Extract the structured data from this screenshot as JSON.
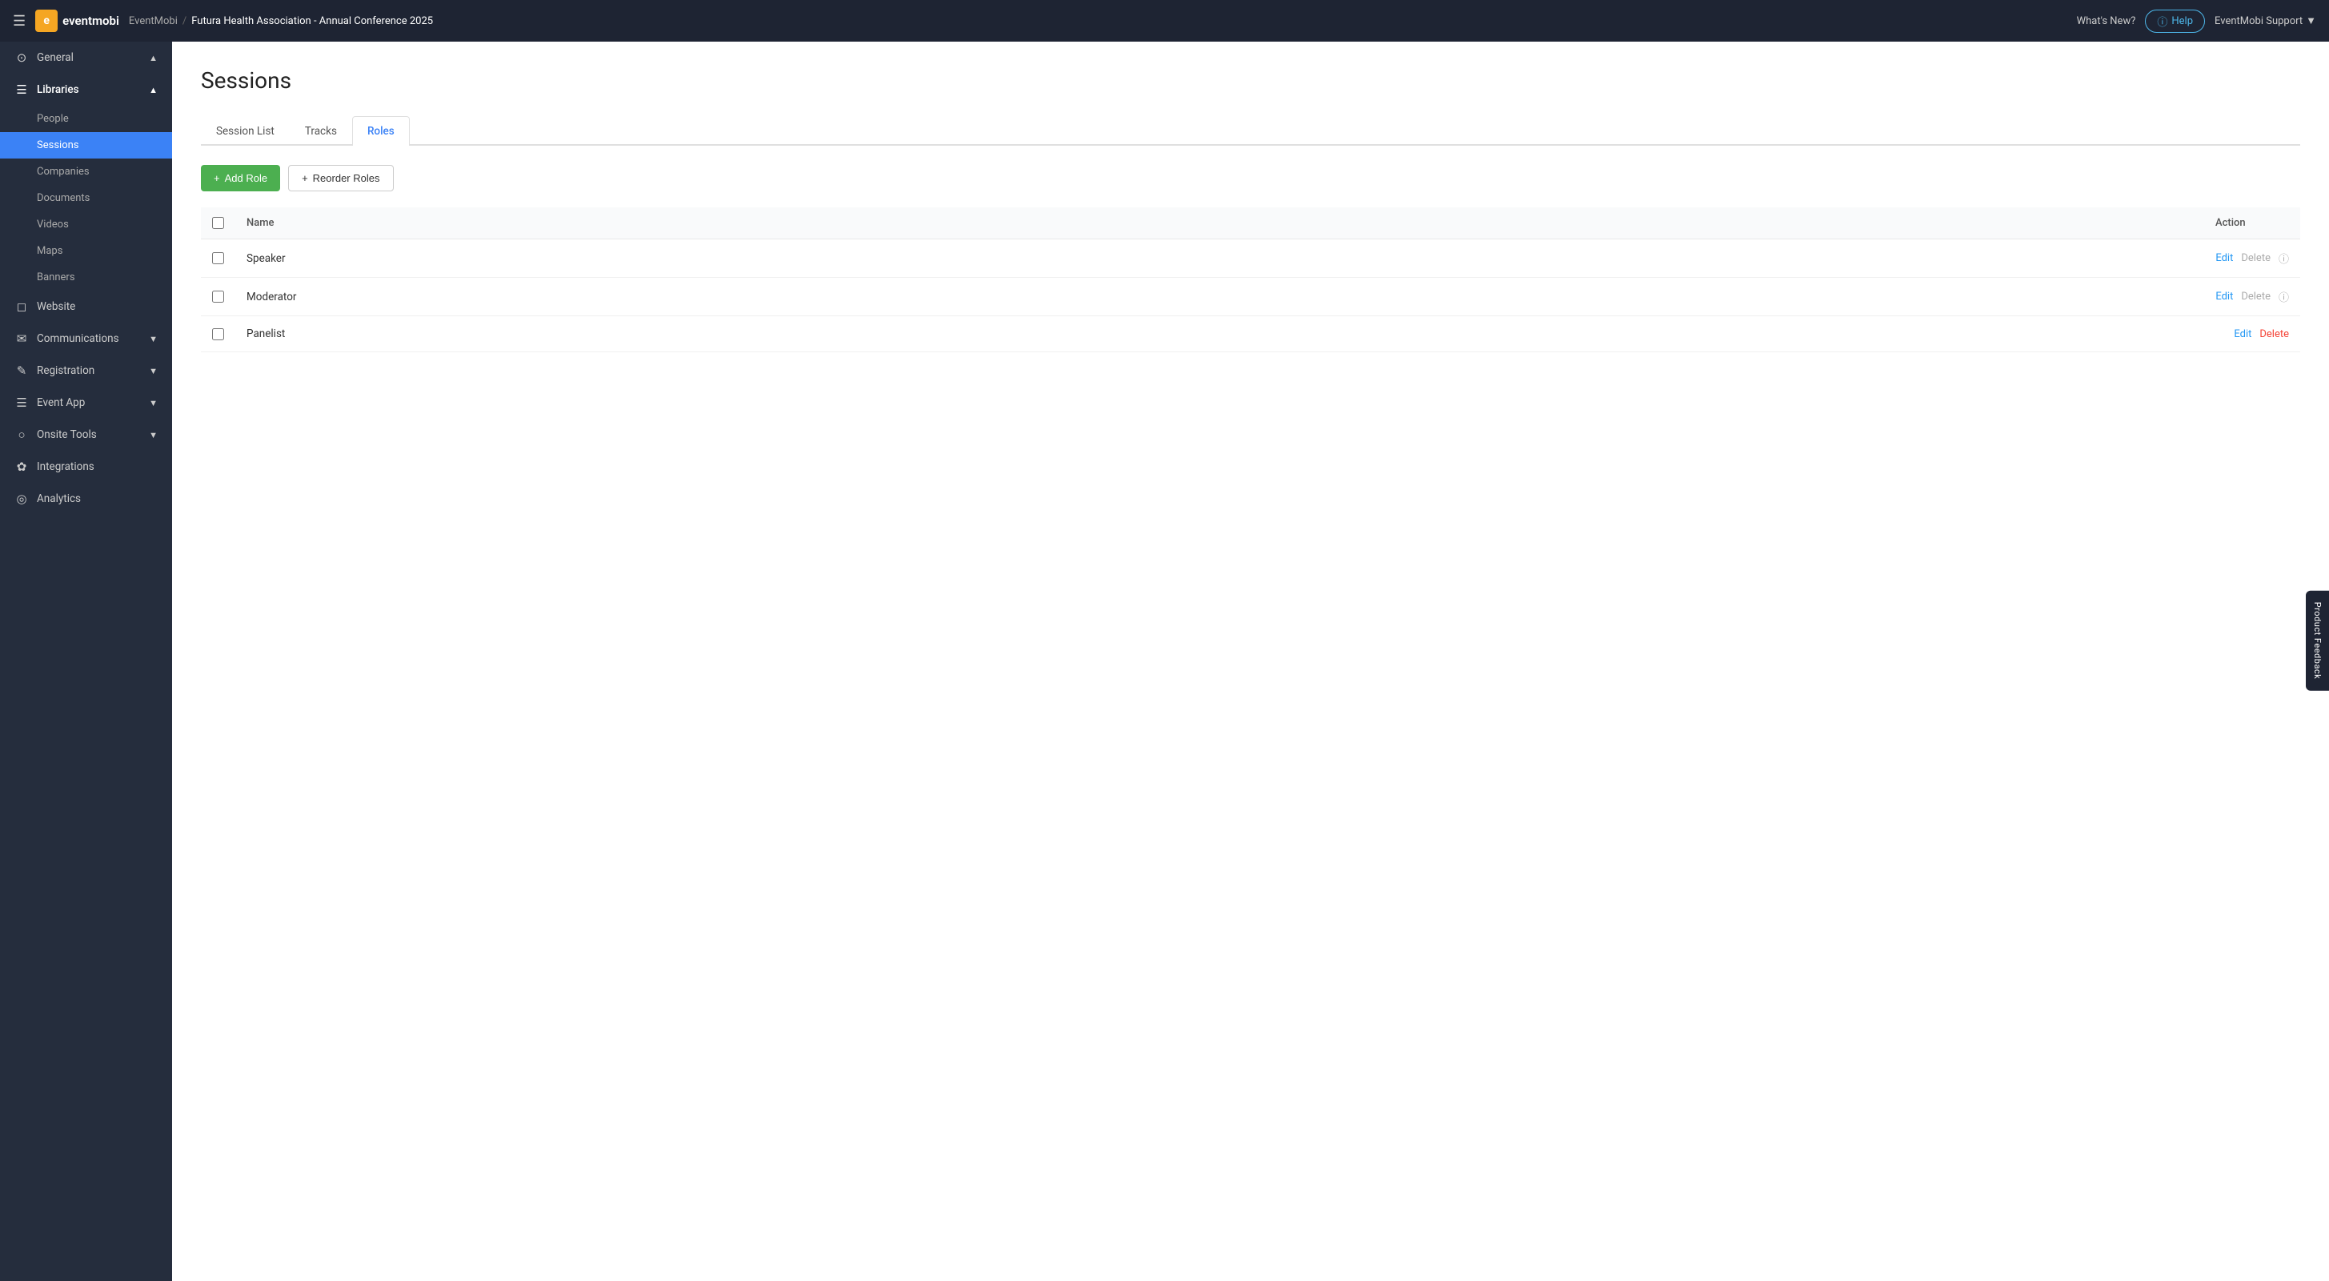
{
  "navbar": {
    "hamburger": "☰",
    "logo_icon": "e",
    "logo_text": "eventmobi",
    "breadcrumb_org": "EventMobi",
    "breadcrumb_sep": "/",
    "event_name": "Futura Health Association - Annual Conference 2025",
    "whats_new": "What's New?",
    "help_label": "Help",
    "support_label": "EventMobi Support"
  },
  "sidebar": {
    "items": [
      {
        "id": "general",
        "icon": "⊙",
        "label": "General",
        "has_chevron": true,
        "chevron": "▲"
      },
      {
        "id": "libraries",
        "icon": "☰",
        "label": "Libraries",
        "has_chevron": true,
        "chevron": "▲",
        "active": false,
        "section": true
      },
      {
        "id": "people",
        "icon": "",
        "label": "People",
        "sub": true
      },
      {
        "id": "sessions",
        "icon": "",
        "label": "Sessions",
        "sub": true,
        "active": true
      },
      {
        "id": "companies",
        "icon": "",
        "label": "Companies",
        "sub": true
      },
      {
        "id": "documents",
        "icon": "",
        "label": "Documents",
        "sub": true
      },
      {
        "id": "videos",
        "icon": "",
        "label": "Videos",
        "sub": true
      },
      {
        "id": "maps",
        "icon": "",
        "label": "Maps",
        "sub": true
      },
      {
        "id": "banners",
        "icon": "",
        "label": "Banners",
        "sub": true
      },
      {
        "id": "website",
        "icon": "⬡",
        "label": "Website",
        "has_chevron": false
      },
      {
        "id": "communications",
        "icon": "✉",
        "label": "Communications",
        "has_chevron": true,
        "chevron": "▼"
      },
      {
        "id": "registration",
        "icon": "✏",
        "label": "Registration",
        "has_chevron": true,
        "chevron": "▼"
      },
      {
        "id": "event-app",
        "icon": "☰",
        "label": "Event App",
        "has_chevron": true,
        "chevron": "▼"
      },
      {
        "id": "onsite-tools",
        "icon": "○",
        "label": "Onsite Tools",
        "has_chevron": true,
        "chevron": "▼"
      },
      {
        "id": "integrations",
        "icon": "✿",
        "label": "Integrations",
        "has_chevron": false
      },
      {
        "id": "analytics",
        "icon": "◎",
        "label": "Analytics",
        "has_chevron": false
      }
    ]
  },
  "page": {
    "title": "Sessions"
  },
  "tabs": [
    {
      "id": "session-list",
      "label": "Session List",
      "active": false
    },
    {
      "id": "tracks",
      "label": "Tracks",
      "active": false
    },
    {
      "id": "roles",
      "label": "Roles",
      "active": true
    }
  ],
  "toolbar": {
    "add_role_label": "Add Role",
    "reorder_roles_label": "Reorder Roles",
    "plus_icon": "+"
  },
  "table": {
    "headers": {
      "name": "Name",
      "action": "Action"
    },
    "rows": [
      {
        "id": 1,
        "name": "Speaker",
        "edit": "Edit",
        "delete": "Delete",
        "has_info": true,
        "delete_active": false
      },
      {
        "id": 2,
        "name": "Moderator",
        "edit": "Edit",
        "delete": "Delete",
        "has_info": true,
        "delete_active": false
      },
      {
        "id": 3,
        "name": "Panelist",
        "edit": "Edit",
        "delete": "Delete",
        "has_info": false,
        "delete_active": true
      }
    ]
  },
  "feedback": {
    "label": "Product Feedback"
  }
}
